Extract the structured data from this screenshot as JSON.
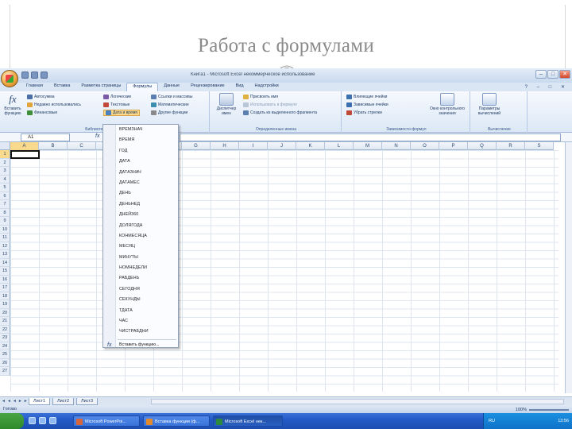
{
  "slide": {
    "title": "Работа с формулами"
  },
  "window": {
    "title": "Книга1 - Microsoft Excel некоммерческое использование",
    "min": "–",
    "max": "□",
    "close": "✕"
  },
  "tabs": [
    "Главная",
    "Вставка",
    "Разметка страницы",
    "Формулы",
    "Данные",
    "Рецензирование",
    "Вид",
    "Надстройки"
  ],
  "active_tab_index": 3,
  "ribbon": {
    "insert_function": "Вставить функцию",
    "autosum": "Автосумма",
    "recent": "Недавно использовались",
    "financial": "Финансовые",
    "logical": "Логические",
    "text": "Текстовые",
    "datetime": "Дата и время",
    "lookup": "Ссылки и массивы",
    "math": "Математические",
    "more": "Другие функции",
    "library_label": "Библиотека функций",
    "name_manager": "Диспетчер имен",
    "assign_name": "Присвоить имя",
    "use_in_formula": "Использовать в формуле",
    "create_from_selection": "Создать из выделенного фрагмента",
    "defined_names_label": "Определенные имена",
    "trace_precedents": "Влияющие ячейки",
    "trace_dependents": "Зависимые ячейки",
    "remove_arrows": "Убрать стрелки",
    "watch_window": "Окно контрольного значения",
    "audit_label": "Зависимости формул",
    "calc_options": "Параметры вычислений",
    "calc_label": "Вычисление"
  },
  "name_box": "A1",
  "columns": [
    "A",
    "B",
    "C",
    "D",
    "E",
    "F",
    "G",
    "H",
    "I",
    "J",
    "K",
    "L",
    "M",
    "N",
    "O",
    "P",
    "Q",
    "R",
    "S"
  ],
  "rows": [
    "1",
    "2",
    "3",
    "4",
    "5",
    "6",
    "7",
    "8",
    "9",
    "10",
    "11",
    "12",
    "13",
    "14",
    "15",
    "16",
    "17",
    "18",
    "19",
    "20",
    "21",
    "22",
    "23",
    "24",
    "25",
    "26",
    "27"
  ],
  "function_menu": {
    "items": [
      "ВРЕМЗНАЧ",
      "ВРЕМЯ",
      "ГОД",
      "ДАТА",
      "ДАТАЗНАЧ",
      "ДАТАМЕС",
      "ДЕНЬ",
      "ДЕНЬНЕД",
      "ДНЕЙ360",
      "ДОЛЯГОДА",
      "КОНМЕСЯЦА",
      "МЕСЯЦ",
      "МИНУТЫ",
      "НОМНЕДЕЛИ",
      "РАБДЕНЬ",
      "СЕГОДНЯ",
      "СЕКУНДЫ",
      "ТДАТА",
      "ЧАС",
      "ЧИСТРАБДНИ"
    ],
    "insert": "Вставить функцию..."
  },
  "sheets": [
    "Лист1",
    "Лист2",
    "Лист3"
  ],
  "status": {
    "left": "Готово",
    "zoom": "100%"
  },
  "taskbar": {
    "items": [
      "Microsoft PowerPoi...",
      "Вставка функции (ф...",
      "Microsoft Excel нек..."
    ],
    "lang": "RU",
    "clock": "13:56"
  }
}
